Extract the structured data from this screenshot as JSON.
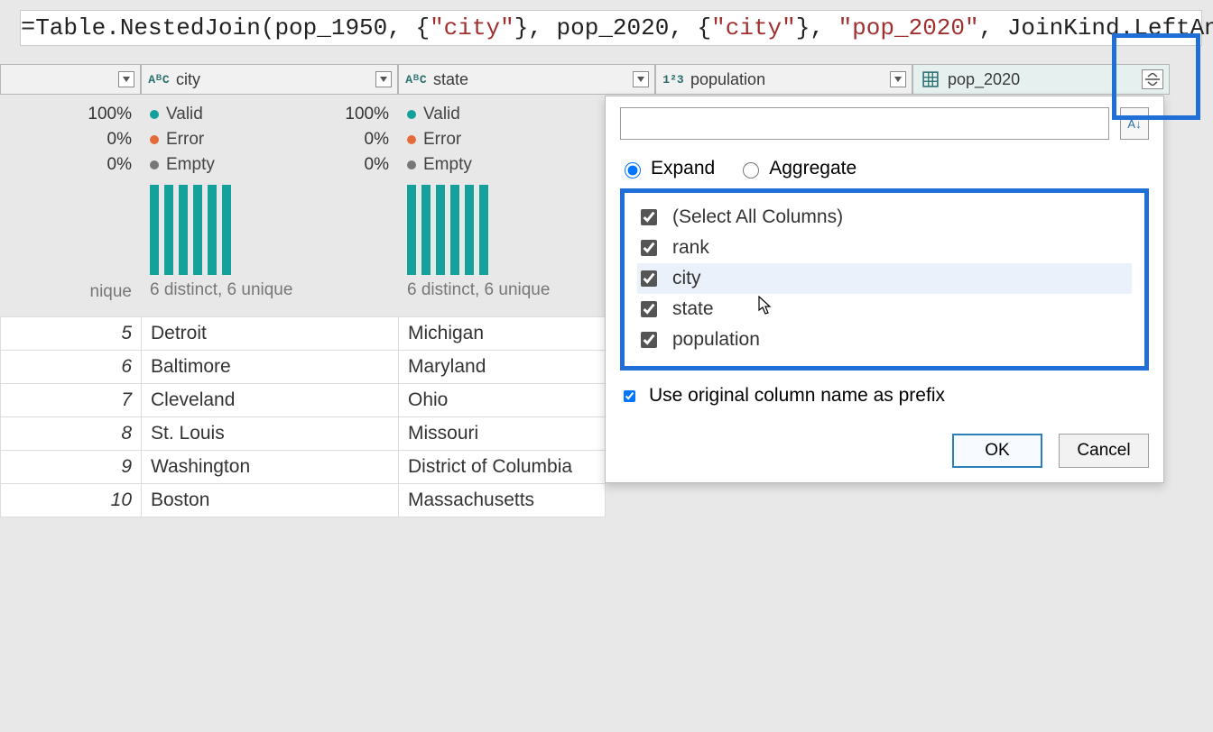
{
  "formula": {
    "tokens": [
      {
        "t": "Table.NestedJoin(pop_1950, {",
        "c": "t-ident"
      },
      {
        "t": "\"city\"",
        "c": "t-str"
      },
      {
        "t": "}, pop_2020, {",
        "c": "t-ident"
      },
      {
        "t": "\"city\"",
        "c": "t-str"
      },
      {
        "t": "}, ",
        "c": "t-ident"
      },
      {
        "t": "\"pop_2020\"",
        "c": "t-str"
      },
      {
        "t": ", JoinKind.LeftAnti)",
        "c": "t-ident"
      }
    ]
  },
  "columns": {
    "rank_dropdown": "",
    "city": "city",
    "state": "state",
    "population": "population",
    "pop2020": "pop_2020",
    "type_text": "AᴮC",
    "type_num": "1²3"
  },
  "stats": {
    "valid_label": "Valid",
    "error_label": "Error",
    "empty_label": "Empty",
    "valid_pct": "100%",
    "error_pct": "0%",
    "empty_pct": "0%",
    "distinct": "6 distinct, 6 unique",
    "nique": "nique"
  },
  "rows": [
    {
      "rank": "5",
      "city": "Detroit",
      "state": "Michigan"
    },
    {
      "rank": "6",
      "city": "Baltimore",
      "state": "Maryland"
    },
    {
      "rank": "7",
      "city": "Cleveland",
      "state": "Ohio"
    },
    {
      "rank": "8",
      "city": "St. Louis",
      "state": "Missouri"
    },
    {
      "rank": "9",
      "city": "Washington",
      "state": "District of Columbia"
    },
    {
      "rank": "10",
      "city": "Boston",
      "state": "Massachusetts"
    }
  ],
  "panel": {
    "search_placeholder": "",
    "expand": "Expand",
    "aggregate": "Aggregate",
    "select_all": "(Select All Columns)",
    "items": [
      "rank",
      "city",
      "state",
      "population"
    ],
    "prefix": "Use original column name as prefix",
    "ok": "OK",
    "cancel": "Cancel",
    "sort_label": "A↓"
  },
  "pop_partial": "1"
}
